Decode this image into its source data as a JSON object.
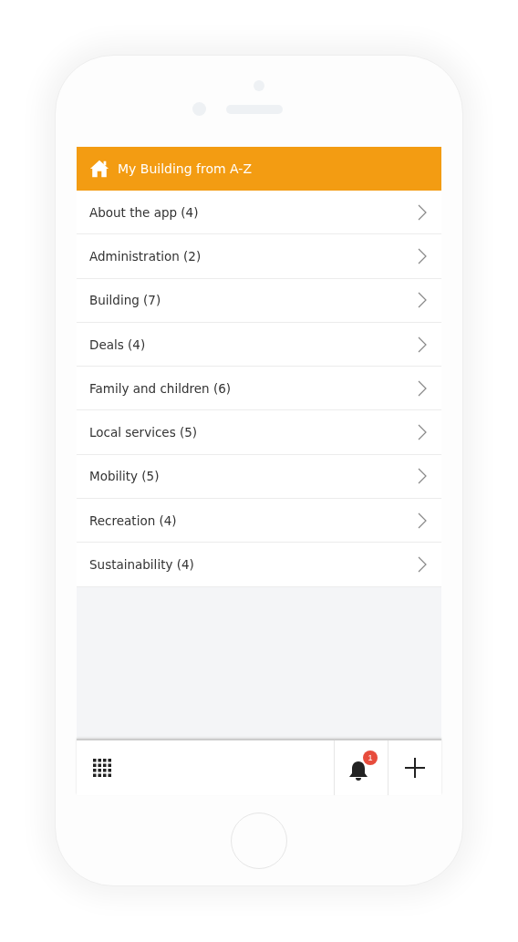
{
  "header": {
    "title": "My Building from A-Z"
  },
  "items": [
    {
      "label": "About the app (4)"
    },
    {
      "label": "Administration (2)"
    },
    {
      "label": "Building (7)"
    },
    {
      "label": "Deals (4)"
    },
    {
      "label": "Family and children (6)"
    },
    {
      "label": "Local services (5)"
    },
    {
      "label": "Mobility (5)"
    },
    {
      "label": "Recreation (4)"
    },
    {
      "label": "Sustainability (4)"
    }
  ],
  "bottom_bar": {
    "notification_count": "1"
  }
}
